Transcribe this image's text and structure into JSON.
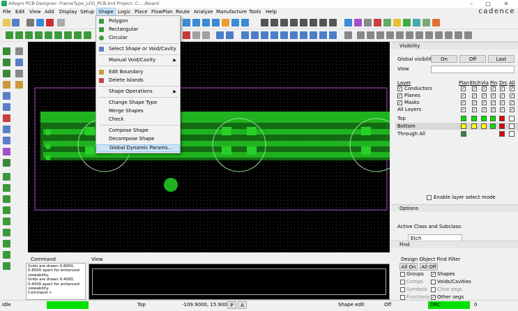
{
  "window": {
    "title": "Allegro PCB Designer: FrameType_LED_PCB.brd  Project: C:.../Board",
    "brand": "cadence",
    "controls": [
      "–",
      "□",
      "✕"
    ]
  },
  "menubar": [
    "File",
    "Edit",
    "View",
    "Add",
    "Display",
    "Setup",
    "Shape",
    "Logic",
    "Place",
    "FlowPlan",
    "Route",
    "Analyze",
    "Manufacture",
    "Tools",
    "Help"
  ],
  "active_menu": "Shape",
  "shape_menu": {
    "items": [
      {
        "label": "Polygon",
        "icon": "polygon-icon",
        "submenu": false
      },
      {
        "label": "Rectangular",
        "icon": "rectangle-shape-icon",
        "submenu": false
      },
      {
        "label": "Circular",
        "icon": "circle-shape-icon",
        "submenu": false
      },
      {
        "label": "Select Shape or Void/Cavity",
        "icon": "select-shape-icon",
        "submenu": false
      },
      {
        "label": "Manual Void/Cavity",
        "icon": "",
        "submenu": true
      },
      {
        "label": "Edit Boundary",
        "icon": "edit-boundary-icon",
        "submenu": false
      },
      {
        "label": "Delete Islands",
        "icon": "delete-islands-icon",
        "submenu": false
      },
      {
        "label": "Shape Operations",
        "icon": "",
        "submenu": true
      },
      {
        "label": "Change Shape Type",
        "icon": "",
        "submenu": false
      },
      {
        "label": "Merge Shapes",
        "icon": "",
        "submenu": false
      },
      {
        "label": "Check",
        "icon": "",
        "submenu": false
      },
      {
        "label": "Compose Shape",
        "icon": "",
        "submenu": false
      },
      {
        "label": "Decompose Shape",
        "icon": "",
        "submenu": false
      },
      {
        "label": "Global Dynamic Params...",
        "icon": "",
        "submenu": false
      }
    ],
    "highlighted": "Global Dynamic Params..."
  },
  "visibility": {
    "title": "Visibility",
    "global_visibility_label": "Global visibility",
    "on_label": "On",
    "off_label": "Off",
    "last_label": "Last",
    "view_label": "View",
    "view_value": "",
    "layer_header": "Layer",
    "columns": [
      "Plan",
      "Etch",
      "Via",
      "Pin",
      "Drc",
      "All"
    ],
    "groups": [
      {
        "name": "Conductors",
        "checked": true
      },
      {
        "name": "Planes",
        "checked": true
      },
      {
        "name": "Masks",
        "checked": true
      },
      {
        "name": "All Layers",
        "checked": true
      }
    ],
    "layers": [
      {
        "name": "Top",
        "colors": [
          "#00e000",
          "#00e000",
          "#00e000",
          "#00e000",
          "#e00000",
          "#ffffff"
        ]
      },
      {
        "name": "Bottom",
        "colors": [
          "#ffff00",
          "#ffff00",
          "#ffff00",
          "#00e000",
          "#e00000",
          "#ffffff"
        ]
      },
      {
        "name": "Through All",
        "colors": [
          "#408040",
          "",
          "",
          "",
          "#e00000",
          "#ffffff"
        ]
      }
    ],
    "enable_layer_select_label": "Enable layer select mode"
  },
  "options": {
    "title": "Options",
    "active_class_label": "Active Class and Subclass:",
    "class_value": "Etch"
  },
  "find": {
    "title": "Find",
    "filter_label": "Design Object Find Filter",
    "all_on": "All On",
    "all_off": "All Off",
    "items": [
      {
        "label": "Groups",
        "checked": false
      },
      {
        "label": "Shapes",
        "checked": true
      },
      {
        "label": "Comps",
        "checked": false
      },
      {
        "label": "Voids/Cavities",
        "checked": false
      },
      {
        "label": "Symbols",
        "checked": false
      },
      {
        "label": "Cline segs",
        "checked": false
      },
      {
        "label": "Functions",
        "checked": false
      },
      {
        "label": "Other segs",
        "checked": true
      }
    ]
  },
  "command": {
    "title": "Command",
    "lines": [
      "Grids are drawn 0.8000,",
      "0.8000 apart for enhanced",
      "viewability.",
      "Grids are drawn 0.4000,",
      "0.4000 apart for enhanced",
      "viewability.",
      "Command >"
    ]
  },
  "view_panel": {
    "title": "View"
  },
  "status": {
    "mode": "Idle",
    "layer": "Top",
    "coords": "-109.9000, 15.9000",
    "p_btn": "P",
    "a_btn": "A",
    "shape_mode": "Shape edit",
    "off": "Off",
    "drc": "DRC",
    "drc_count": "0"
  },
  "colors": {
    "board_green": "#1fb31f",
    "outline_purple": "#b04ec8",
    "status_green": "#00e000"
  }
}
